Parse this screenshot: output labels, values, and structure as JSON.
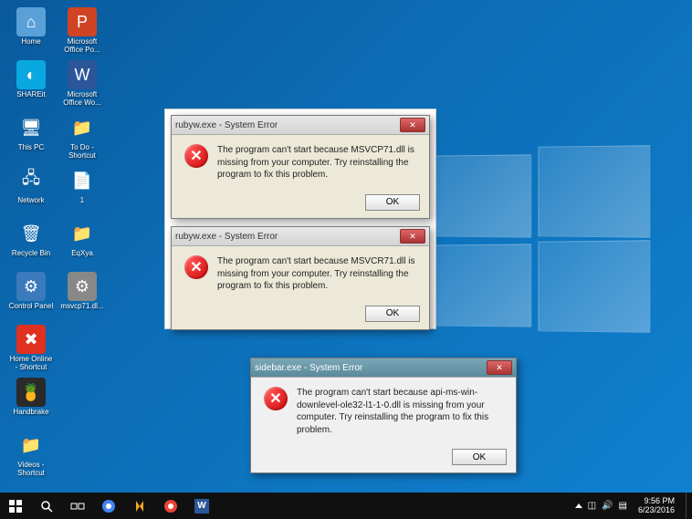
{
  "desktop_icons": [
    {
      "label": "Home",
      "glyph": "⌂",
      "bg": "#5aa0d8"
    },
    {
      "label": "Microsoft Office Po...",
      "glyph": "P",
      "bg": "#d04423"
    },
    {
      "label": "SHAREit",
      "glyph": "◐",
      "bg": "#0aa8e0"
    },
    {
      "label": "Microsoft Office Wo...",
      "glyph": "W",
      "bg": "#2b579a"
    },
    {
      "label": "This PC",
      "glyph": "🖥",
      "bg": "transparent"
    },
    {
      "label": "To Do - Shortcut",
      "glyph": "📁",
      "bg": "transparent"
    },
    {
      "label": "Network",
      "glyph": "🖧",
      "bg": "transparent"
    },
    {
      "label": "1",
      "glyph": "📄",
      "bg": "transparent"
    },
    {
      "label": "Recycle Bin",
      "glyph": "🗑",
      "bg": "transparent"
    },
    {
      "label": "EqXya",
      "glyph": "📁",
      "bg": "transparent"
    },
    {
      "label": "Control Panel",
      "glyph": "⚙",
      "bg": "#3a7abd"
    },
    {
      "label": "msvcp71.dl...",
      "glyph": "⚙",
      "bg": "#888"
    },
    {
      "label": "Home Online - Shortcut",
      "glyph": "✖",
      "bg": "#e03020"
    },
    {
      "label": "",
      "glyph": "",
      "bg": "transparent"
    },
    {
      "label": "Handbrake",
      "glyph": "🍍",
      "bg": "#2a2a2a"
    },
    {
      "label": "",
      "glyph": "",
      "bg": "transparent"
    },
    {
      "label": "Videos - Shortcut",
      "glyph": "📁",
      "bg": "transparent"
    }
  ],
  "dialogs": [
    {
      "title": "rubyw.exe - System Error",
      "msg": "The program can't start because MSVCP71.dll is missing from your computer. Try reinstalling the program to fix this problem.",
      "ok": "OK",
      "aero": false
    },
    {
      "title": "rubyw.exe - System Error",
      "msg": "The program can't start because MSVCR71.dll is missing from your computer. Try reinstalling the program to fix this problem.",
      "ok": "OK",
      "aero": false
    },
    {
      "title": "sidebar.exe - System Error",
      "msg": "The program can't start because api-ms-win-downlevel-ole32-l1-1-0.dll is missing from your computer. Try reinstalling the program to fix this problem.",
      "ok": "OK",
      "aero": true
    }
  ],
  "taskbar": {
    "time": "9:56 PM",
    "date": "6/23/2016"
  }
}
